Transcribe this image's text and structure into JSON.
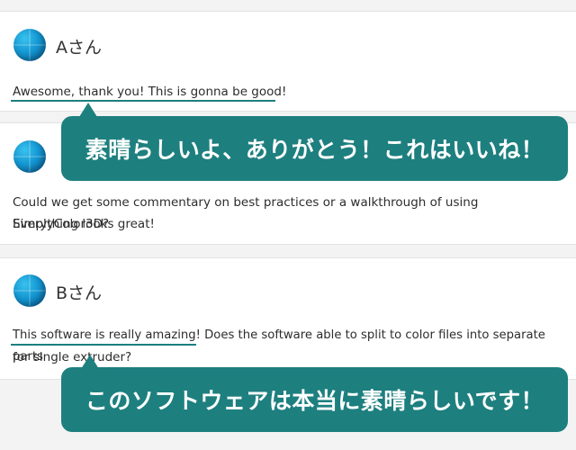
{
  "comments": [
    {
      "user": "Aさん",
      "text": "Awesome, thank you! This is gonna be good!",
      "translation": "素晴らしいよ、ありがとう！これはいいね！"
    },
    {
      "user": "",
      "text_line1": "Could we get some commentary on best practices or a walkthrough of using SimplyColor3D?",
      "text_line2": "Everything looks great!"
    },
    {
      "user": "Bさん",
      "text_line1": "This software is really amazing! Does the software able to split to color files into separate parts",
      "text_line2": "for single extruder?",
      "translation": "このソフトウェアは本当に素晴らしいです！"
    }
  ],
  "colors": {
    "bubble": "#1e7f7f",
    "underline": "#1d7f80",
    "avatar": "#1497d2"
  },
  "icons": {
    "avatar": "blue-sphere-avatar-icon"
  }
}
